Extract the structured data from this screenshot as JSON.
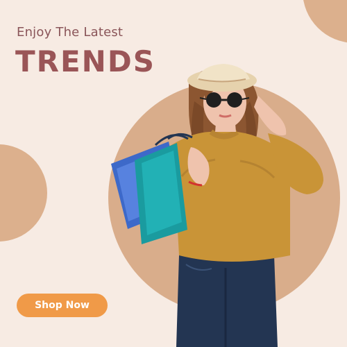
{
  "banner": {
    "subtitle": "Enjoy The Latest",
    "title": "TRENDS",
    "cta_label": "Shop Now"
  },
  "image": {
    "description_name": "model-photo"
  },
  "colors": {
    "background": "#f7ebe3",
    "accent_circle": "#d9ad8b",
    "title": "#9a5557",
    "subtitle": "#8a5559",
    "button": "#f09a48",
    "button_text": "#ffffff"
  }
}
